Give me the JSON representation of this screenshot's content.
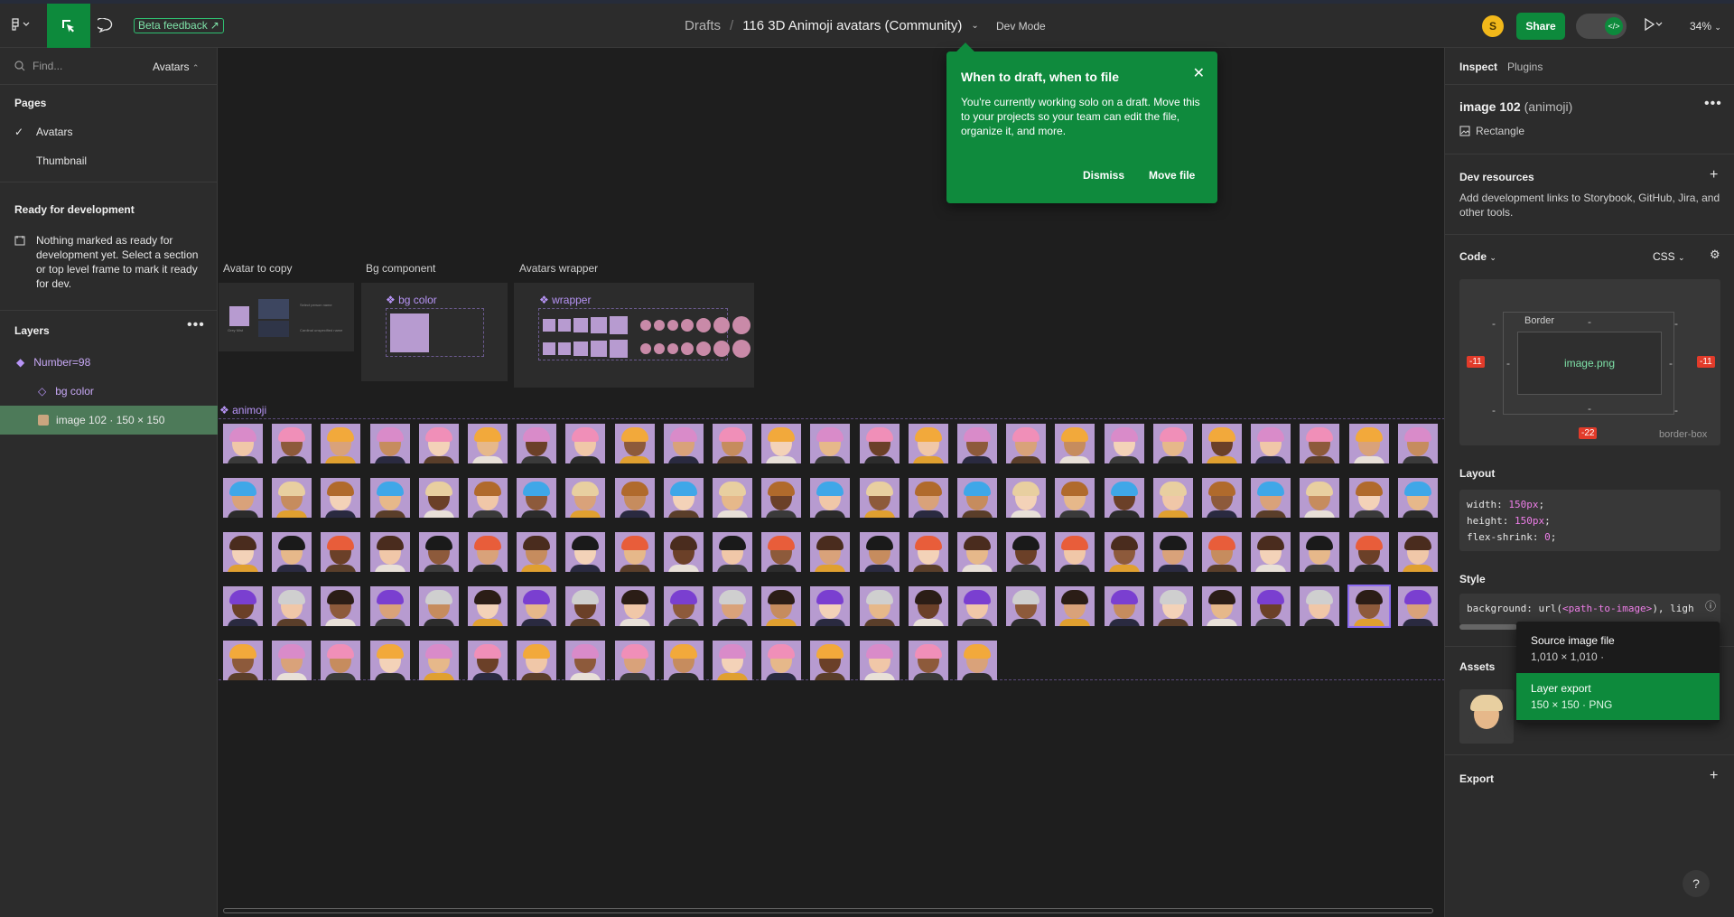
{
  "topbar": {
    "beta_label": "Beta feedback",
    "breadcrumb_root": "Drafts",
    "breadcrumb_sep": "/",
    "file_name": "116 3D Animoji avatars (Community)",
    "dev_mode": "Dev Mode",
    "user_initial": "S",
    "share_label": "Share",
    "zoom": "34%"
  },
  "left": {
    "search_placeholder": "Find...",
    "page_switch": "Avatars",
    "pages_title": "Pages",
    "pages": [
      "Avatars",
      "Thumbnail"
    ],
    "current_page": "Avatars",
    "ready_title": "Ready for development",
    "ready_text": "Nothing marked as ready for development yet. Select a section or top level frame to mark it ready for dev.",
    "layers_title": "Layers",
    "layers": [
      {
        "label": "Number=98"
      },
      {
        "label": "bg color"
      },
      {
        "label": "image 102 · 150 × 150"
      }
    ]
  },
  "canvas": {
    "frames": [
      "Avatar to copy",
      "Bg component",
      "Avatars wrapper"
    ],
    "bg_color_label": "bg color",
    "wrapper_label": "wrapper",
    "animoji_label": "animoji",
    "copy_frame_notes": [
      "Select person name",
      "Cardinal unspecified name",
      "Grey Mist"
    ]
  },
  "popover": {
    "title": "When to draft, when to file",
    "body": "You're currently working solo on a draft. Move this to your projects so your team can edit the file, organize it, and more.",
    "dismiss": "Dismiss",
    "move": "Move file"
  },
  "right": {
    "tabs": [
      "Inspect",
      "Plugins"
    ],
    "layer_name": "image 102",
    "layer_sub": "(animoji)",
    "layer_type": "Rectangle",
    "dev_resources_title": "Dev resources",
    "dev_resources_text": "Add development links to Storybook, GitHub, Jira, and other tools.",
    "code_title": "Code",
    "code_lang": "CSS",
    "box_border": "Border",
    "box_content": "image.png",
    "box_left": "-11",
    "box_right": "-11",
    "box_bottom": "-22",
    "box_sizing": "border-box",
    "dash": "-",
    "layout_title": "Layout",
    "layout_lines": [
      {
        "prop": "width: ",
        "val": "150px",
        "end": ";"
      },
      {
        "prop": "height: ",
        "val": "150px",
        "end": ";"
      },
      {
        "prop": "flex-shrink: ",
        "val": "0",
        "end": ";"
      }
    ],
    "style_title": "Style",
    "style_prop": "background: url(",
    "style_val": "<path-to-image>",
    "style_end": "), ligh",
    "assets_title": "Assets",
    "export_title": "Export",
    "dropdown": [
      {
        "label": "Source image file",
        "meta": "1,010 × 1,010 ·"
      },
      {
        "label": "Layer export",
        "meta": "150 × 150 · PNG"
      }
    ],
    "help": "?"
  },
  "colors": {
    "accent_green": "#0d8a3c",
    "component_purple": "#b794f6",
    "avatar_bg": "#b79bd0",
    "badge_red": "#e23b2a"
  }
}
